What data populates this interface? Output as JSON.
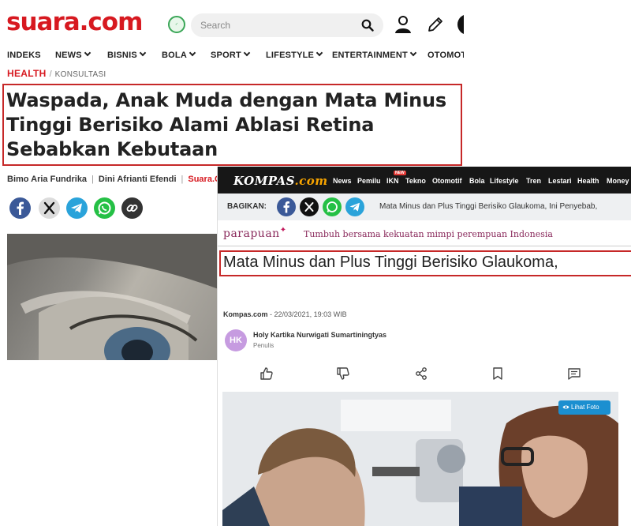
{
  "suara": {
    "logo_main": "suara",
    "logo_suffix": ".com",
    "search_placeholder": "Search",
    "nav": [
      "INDEKS",
      "NEWS",
      "BISNIS",
      "BOLA",
      "SPORT",
      "LIFESTYLE",
      "ENTERTAINMENT",
      "OTOMOTIF"
    ],
    "breadcrumb": {
      "category": "HEALTH",
      "separator": "/",
      "subcategory": "KONSULTASI"
    },
    "headline": "Waspada, Anak Muda dengan Mata Minus Tinggi Berisiko Alami Ablasi Retina Sebabkan Kebutaan",
    "authors": [
      "Bimo Aria Fundrika",
      "Dini Afrianti Efendi"
    ],
    "source": "Suara.C",
    "share_icons": [
      "facebook-icon",
      "x-icon",
      "telegram-icon",
      "whatsapp-icon",
      "link-icon"
    ],
    "colors": {
      "brand": "#d71920",
      "highlight_box": "#c62828"
    }
  },
  "kompas": {
    "logo_main": "KOMPAS",
    "logo_suffix": ".com",
    "nav": [
      "News",
      "Pemilu",
      "IKN",
      "Tekno",
      "Otomotif",
      "Bola",
      "Lifestyle",
      "Tren",
      "Lestari",
      "Health",
      "Money"
    ],
    "new_badge": "NEW",
    "share_label": "BAGIKAN:",
    "share_title": "Mata Minus dan Plus Tinggi Berisiko Glaukoma, Ini Penyebab,",
    "parapuan_logo": "parapuan",
    "parapuan_tagline": "Tumbuh bersama kekuatan mimpi perempuan Indonesia",
    "headline": "Mata Minus dan Plus Tinggi Berisiko Glaukoma,",
    "meta_source": "Kompas.com",
    "meta_date": "- 22/03/2021, 19:03 WIB",
    "author_initials": "HK",
    "author_name": "Holy Kartika Nurwigati Sumartiningtyas",
    "author_role": "Penulis",
    "action_icons": [
      "thumbs-up-icon",
      "thumbs-down-icon",
      "share-icon",
      "bookmark-icon",
      "comment-icon"
    ],
    "lihat_foto": "Lihat Foto",
    "colors": {
      "topbar": "#171717",
      "accent": "#f7a400",
      "parapuan": "#8a2a5c",
      "button": "#1b8fd0"
    }
  }
}
